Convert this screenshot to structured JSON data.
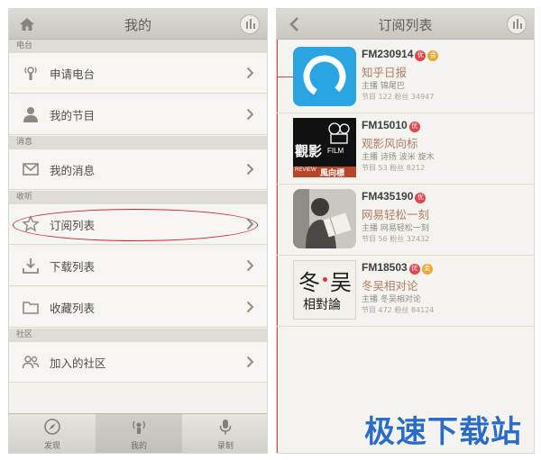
{
  "left": {
    "title": "我的",
    "sections": {
      "radio": "电台",
      "messages": "消息",
      "listen": "收听",
      "community": "社区"
    },
    "items": {
      "apply_radio": "申请电台",
      "my_programs": "我的节目",
      "my_messages": "我的消息",
      "subscriptions": "订阅列表",
      "downloads": "下载列表",
      "favorites": "收藏列表",
      "joined_communities": "加入的社区"
    },
    "tabs": {
      "discover": "发现",
      "mine": "我的",
      "record": "录制"
    }
  },
  "right": {
    "title": "订阅列表",
    "items": [
      {
        "fm": "FM230914",
        "name": "知乎日报",
        "host": "主播 锦尾巴",
        "stats": "节目 122   粉丝 34947",
        "thumb": "zhihu-logo"
      },
      {
        "fm": "FM15010",
        "name": "观影风向标",
        "host": "主播 诗扬 波米 旋木",
        "stats": "节目 53   粉丝 8212",
        "thumb_text": [
          "觀影",
          "FILM",
          "REVIEW",
          "風向標"
        ]
      },
      {
        "fm": "FM435190",
        "name": "网易轻松一刻",
        "host": "主播 网易轻松一刻",
        "stats": "节目 56   粉丝 32432",
        "thumb": "reading-man-photo"
      },
      {
        "fm": "FM18503",
        "name": "冬吴相对论",
        "host": "主播 冬吴相对论",
        "stats": "节目 472   粉丝 84124",
        "thumb_text": [
          "冬",
          "吴",
          "相對論"
        ]
      }
    ],
    "badges": {
      "you": "优",
      "gold": "金"
    }
  },
  "watermark": "极速下载站",
  "colors": {
    "highlight": "#c8282d",
    "accent_text": "#b07e62",
    "watermark": "#2b6cc9"
  }
}
